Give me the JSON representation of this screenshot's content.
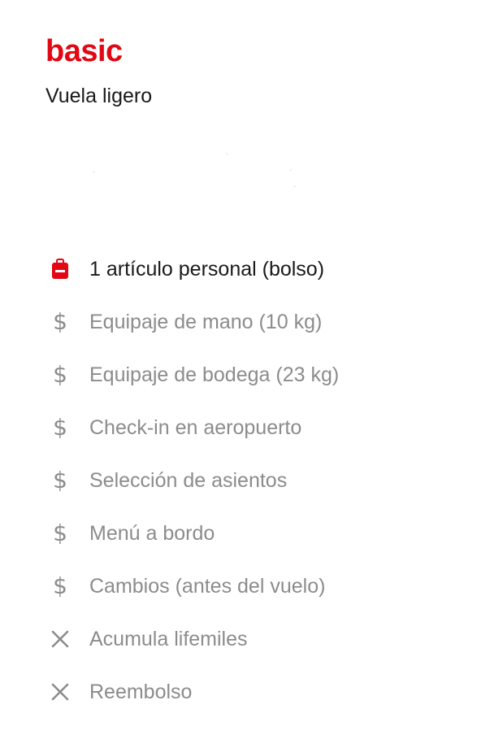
{
  "fare": {
    "name": "basic",
    "tagline": "Vuela ligero"
  },
  "colors": {
    "brand": "#e30613",
    "included_text": "#1a1a1a",
    "extra_text": "#8c8c8c"
  },
  "features": [
    {
      "label": "1 artículo personal (bolso)",
      "status": "included",
      "icon": "bag-icon"
    },
    {
      "label": "Equipaje de mano (10 kg)",
      "status": "paid",
      "icon": "dollar-icon"
    },
    {
      "label": "Equipaje de bodega (23 kg)",
      "status": "paid",
      "icon": "dollar-icon"
    },
    {
      "label": "Check-in en aeropuerto",
      "status": "paid",
      "icon": "dollar-icon"
    },
    {
      "label": "Selección de asientos",
      "status": "paid",
      "icon": "dollar-icon"
    },
    {
      "label": "Menú a bordo",
      "status": "paid",
      "icon": "dollar-icon"
    },
    {
      "label": "Cambios (antes del vuelo)",
      "status": "paid",
      "icon": "dollar-icon"
    },
    {
      "label": "Acumula lifemiles",
      "status": "not_included",
      "icon": "close-icon"
    },
    {
      "label": "Reembolso",
      "status": "not_included",
      "icon": "close-icon"
    }
  ]
}
